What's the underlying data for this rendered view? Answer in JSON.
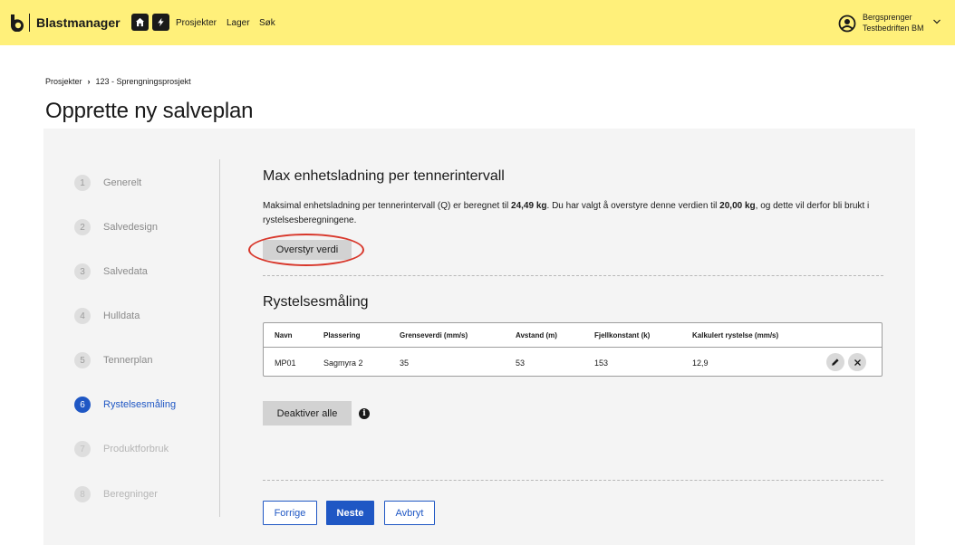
{
  "header": {
    "brand": "Blastmanager",
    "logo_icon": "blastmanager-logo-icon",
    "nav_icons": [
      "home-icon",
      "lightning-icon"
    ],
    "nav_links": [
      "Prosjekter",
      "Lager",
      "Søk"
    ],
    "user": {
      "name": "Bergsprenger",
      "org": "Testbedriften BM",
      "icon": "user-circle-icon"
    },
    "colors": {
      "bar": "#fff07a"
    }
  },
  "breadcrumb": {
    "root": "Prosjekter",
    "separator": "›",
    "current": "123 - Sprengningsprosjekt"
  },
  "page_title": "Opprette ny salveplan",
  "steps": [
    {
      "num": "1",
      "label": "Generelt",
      "state": "done"
    },
    {
      "num": "2",
      "label": "Salvedesign",
      "state": "done"
    },
    {
      "num": "3",
      "label": "Salvedata",
      "state": "done"
    },
    {
      "num": "4",
      "label": "Hulldata",
      "state": "done"
    },
    {
      "num": "5",
      "label": "Tennerplan",
      "state": "done"
    },
    {
      "num": "6",
      "label": "Rystelsesmåling",
      "state": "active"
    },
    {
      "num": "7",
      "label": "Produktforbruk",
      "state": "disabled"
    },
    {
      "num": "8",
      "label": "Beregninger",
      "state": "disabled"
    }
  ],
  "charge_section": {
    "title": "Max enhetsladning per tennerintervall",
    "desc_part1": "Maksimal enhetsladning per tennerintervall (Q) er beregnet til ",
    "calc_value": "24,49 kg",
    "desc_part2": ". Du har valgt å overstyre denne verdien til ",
    "override_value": "20,00 kg",
    "desc_part3": ", og dette vil derfor bli brukt i rystelsesberegningene.",
    "override_button": "Overstyr verdi"
  },
  "vibration_section": {
    "title": "Rystelsesmåling",
    "columns": [
      "Navn",
      "Plassering",
      "Grenseverdi (mm/s)",
      "Avstand (m)",
      "Fjellkonstant (k)",
      "Kalkulert rystelse (mm/s)"
    ],
    "rows": [
      {
        "cells": [
          "MP01",
          "Sagmyra 2",
          "35",
          "53",
          "153",
          "12,9"
        ],
        "actions": [
          "edit-icon",
          "close-icon"
        ]
      }
    ],
    "deactivate_button": "Deaktiver alle",
    "info_icon": "info-icon"
  },
  "footer_buttons": {
    "prev": "Forrige",
    "next": "Neste",
    "cancel": "Avbryt"
  },
  "colors": {
    "primary": "#1f57c4",
    "highlight": "#d8372b",
    "panel": "#f4f4f4"
  }
}
